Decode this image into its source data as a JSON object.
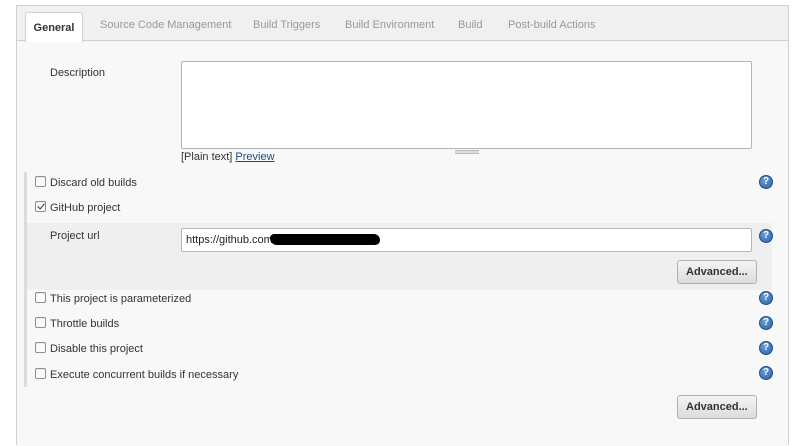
{
  "tabs": [
    "General",
    "Source Code Management",
    "Build Triggers",
    "Build Environment",
    "Build",
    "Post-build Actions"
  ],
  "description": {
    "label": "Description",
    "value": "",
    "plain_text": "[Plain text]",
    "preview_link": "Preview"
  },
  "options": {
    "discard_old_builds": "Discard old builds",
    "github_project": "GitHub project",
    "project_url_label": "Project url",
    "project_url_value": "https://github.com/",
    "parameterized": "This project is parameterized",
    "throttle": "Throttle builds",
    "disable": "Disable this project",
    "concurrent": "Execute concurrent builds if necessary"
  },
  "checked": {
    "discard_old_builds": false,
    "github_project": true,
    "parameterized": false,
    "throttle": false,
    "disable": false,
    "concurrent": false
  },
  "buttons": {
    "advanced_github": "Advanced...",
    "advanced_general": "Advanced..."
  },
  "help_glyph": "?",
  "colors": {
    "help_icon": "#2c5f9e",
    "link": "#204a87",
    "active_tab_text": "#333333",
    "inactive_tab_text": "#999999"
  }
}
